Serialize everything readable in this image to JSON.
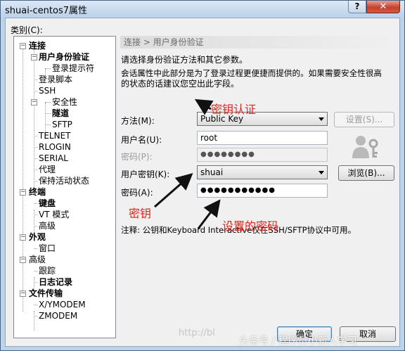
{
  "window": {
    "title": "shuai-centos7属性",
    "help_label": "?",
    "close_label": "✕"
  },
  "category_label": "类别(C):",
  "tree": {
    "items": [
      {
        "label": "连接",
        "bold": true
      },
      {
        "label": "用户身份验证",
        "bold": true,
        "selected": true
      },
      {
        "label": "登录提示符",
        "bold": false
      },
      {
        "label": "登录脚本",
        "bold": false
      },
      {
        "label": "SSH",
        "bold": false
      },
      {
        "label": "安全性",
        "bold": false
      },
      {
        "label": "隧道",
        "bold": true
      },
      {
        "label": "SFTP",
        "bold": false
      },
      {
        "label": "TELNET",
        "bold": false
      },
      {
        "label": "RLOGIN",
        "bold": false
      },
      {
        "label": "SERIAL",
        "bold": false
      },
      {
        "label": "代理",
        "bold": false
      },
      {
        "label": "保持活动状态",
        "bold": false
      },
      {
        "label": "终端",
        "bold": true
      },
      {
        "label": "键盘",
        "bold": true
      },
      {
        "label": "VT 模式",
        "bold": false
      },
      {
        "label": "高级",
        "bold": false
      },
      {
        "label": "外观",
        "bold": true
      },
      {
        "label": "窗口",
        "bold": false
      },
      {
        "label": "高级",
        "bold": false
      },
      {
        "label": "跟踪",
        "bold": false
      },
      {
        "label": "日志记录",
        "bold": true
      },
      {
        "label": "文件传输",
        "bold": true
      },
      {
        "label": "X/YMODEM",
        "bold": false
      },
      {
        "label": "ZMODEM",
        "bold": false
      }
    ]
  },
  "panel": {
    "header": "连接 > 用户身份验证",
    "desc1": "请选择身份验证方法和其它参数。",
    "desc2a": "会话属性中此部分是为了登录过程更便捷而提供的。如果需要安全性很高",
    "desc2b": "的状态的话建议您空出此字段。",
    "method_label": "方法(M):",
    "method_value": "Public Key",
    "settings_button": "设置(S)...",
    "username_label": "用户名(U):",
    "username_value": "root",
    "password_label": "密码(P):",
    "password_value": "●●●●●●●●",
    "userkey_label": "用户密钥(K):",
    "userkey_value": "shuai",
    "browse_button": "浏览(B)...",
    "passphrase_label": "密码(A):",
    "passphrase_value": "●●●●●●●●●●●",
    "note": "注释: 公钥和Keyboard Interactive仅在SSH/SFTP协议中可用。"
  },
  "buttons": {
    "ok": "确定",
    "cancel": "取消"
  },
  "annotations": {
    "key_auth": "密钥认证",
    "key": "密钥",
    "set_password": "设置的密码",
    "color": "#e2231a"
  },
  "watermark": {
    "url_part": "http://bl",
    "text": "头条号 / 程序员小新人学习"
  }
}
